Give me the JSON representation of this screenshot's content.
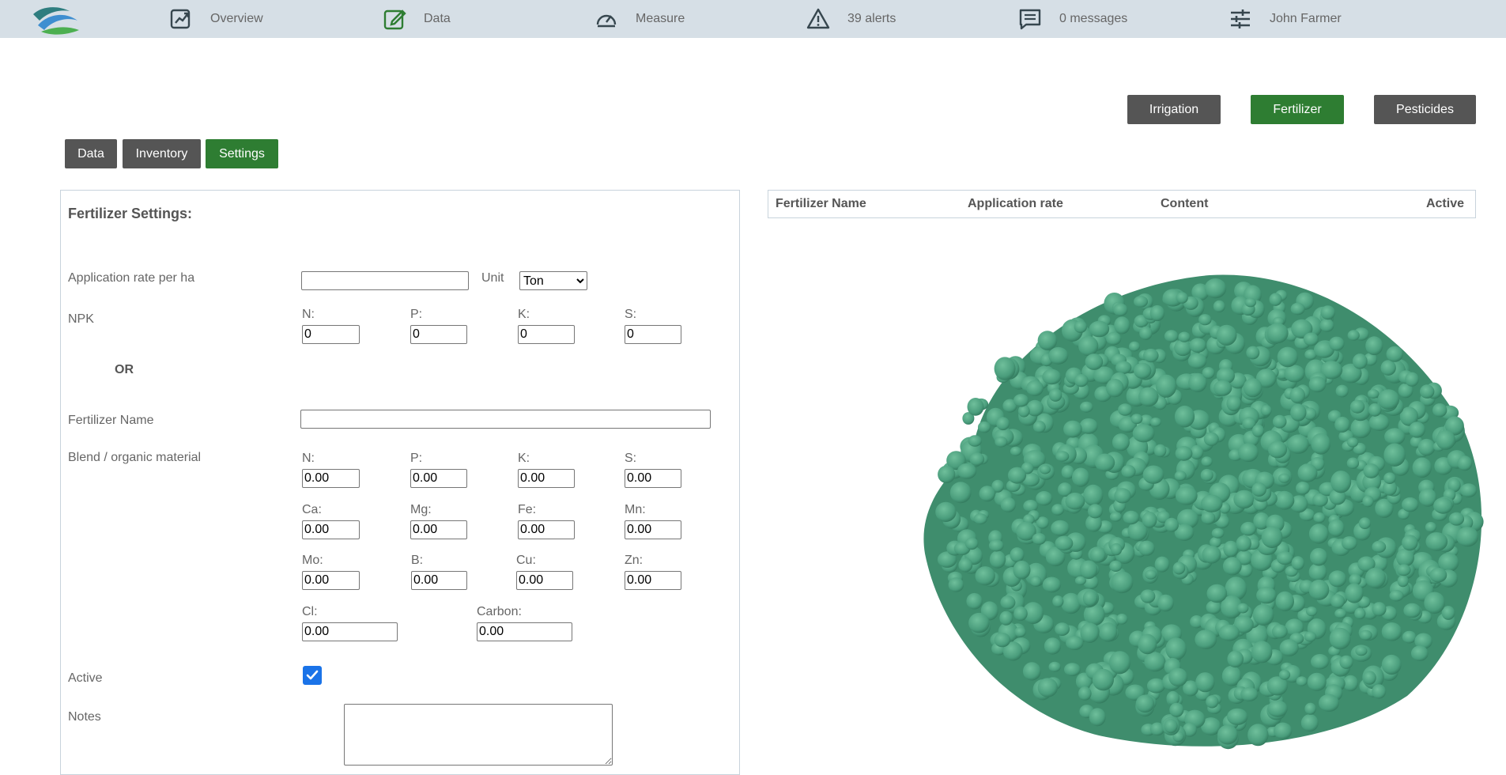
{
  "topnav": {
    "items": [
      {
        "label": "Overview",
        "icon": "overview-chart-icon"
      },
      {
        "label": "Data",
        "icon": "edit-icon"
      },
      {
        "label": "Measure",
        "icon": "gauge-icon"
      },
      {
        "label": "39 alerts",
        "icon": "alert-icon"
      },
      {
        "label": "0 messages",
        "icon": "message-icon"
      },
      {
        "label": "John Farmer",
        "icon": "settings-sliders-icon"
      }
    ]
  },
  "category_tabs": {
    "irrigation": "Irrigation",
    "fertilizer": "Fertilizer",
    "pesticides": "Pesticides"
  },
  "sub_tabs": {
    "data": "Data",
    "inventory": "Inventory",
    "settings": "Settings"
  },
  "form": {
    "title": "Fertilizer Settings:",
    "application_rate_label": "Application rate per ha",
    "application_rate_value": "",
    "unit_label": "Unit",
    "unit_value": "Ton",
    "npk_label": "NPK",
    "npk": [
      {
        "label": "N:",
        "value": "0"
      },
      {
        "label": "P:",
        "value": "0"
      },
      {
        "label": "K:",
        "value": "0"
      },
      {
        "label": "S:",
        "value": "0"
      }
    ],
    "or_label": "OR",
    "fertilizer_name_label": "Fertilizer Name",
    "fertilizer_name_value": "",
    "blend_label": "Blend / organic material",
    "blend_row1": [
      {
        "label": "N:",
        "value": "0.00"
      },
      {
        "label": "P:",
        "value": "0.00"
      },
      {
        "label": "K:",
        "value": "0.00"
      },
      {
        "label": "S:",
        "value": "0.00"
      }
    ],
    "blend_row2": [
      {
        "label": "Ca:",
        "value": "0.00"
      },
      {
        "label": "Mg:",
        "value": "0.00"
      },
      {
        "label": "Fe:",
        "value": "0.00"
      },
      {
        "label": "Mn:",
        "value": "0.00"
      }
    ],
    "blend_row3": [
      {
        "label": "Mo:",
        "value": "0.00"
      },
      {
        "label": "B:",
        "value": "0.00"
      },
      {
        "label": "Cu:",
        "value": "0.00"
      },
      {
        "label": "Zn:",
        "value": "0.00"
      }
    ],
    "blend_row4": [
      {
        "label": "Cl:",
        "value": "0.00"
      },
      {
        "label": "Carbon:",
        "value": "0.00"
      }
    ],
    "active_label": "Active",
    "active_checked": true,
    "notes_label": "Notes",
    "notes_value": ""
  },
  "table": {
    "headers": [
      "Fertilizer Name",
      "Application rate",
      "Content",
      "Active"
    ]
  },
  "colors": {
    "nav_bg": "#d6dfe6",
    "accent_green": "#2e7d32",
    "dark_button": "#555555",
    "fertilizer_granule": "#4a9d7c"
  }
}
